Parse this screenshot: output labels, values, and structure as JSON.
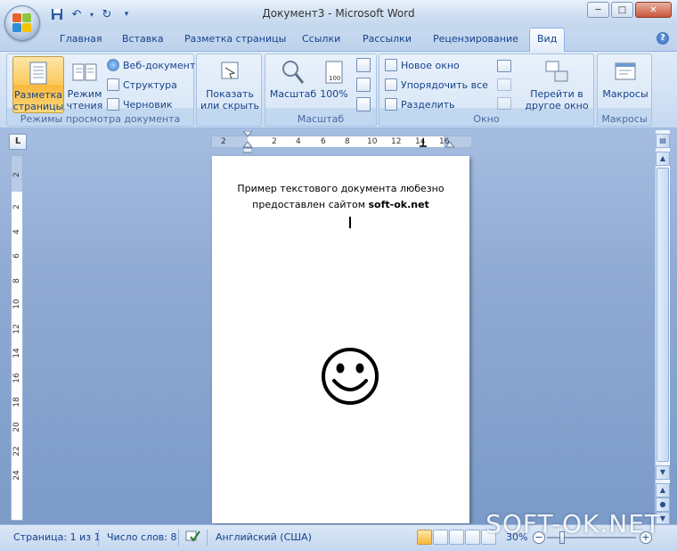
{
  "window": {
    "title": "Документ3 - Microsoft Word"
  },
  "qat": {
    "icons": [
      "save-icon",
      "undo-icon",
      "redo-icon",
      "customize-icon"
    ]
  },
  "tabs": [
    {
      "label": "Главная"
    },
    {
      "label": "Вставка"
    },
    {
      "label": "Разметка страницы"
    },
    {
      "label": "Ссылки"
    },
    {
      "label": "Рассылки"
    },
    {
      "label": "Рецензирование"
    },
    {
      "label": "Вид"
    }
  ],
  "ribbon": {
    "views": {
      "name": "Режимы просмотра документа",
      "page_layout": "Разметка страницы",
      "reading": "Режим чтения",
      "web": "Веб-документ",
      "outline": "Структура",
      "draft": "Черновик"
    },
    "show": {
      "label": "Показать или скрыть"
    },
    "zoom": {
      "name": "Масштаб",
      "zoom_label": "Масштаб",
      "percent_label": "100%"
    },
    "window": {
      "name": "Окно",
      "new_window": "Новое окно",
      "arrange_all": "Упорядочить все",
      "split": "Разделить",
      "switch": "Перейти в другое окно"
    },
    "macros": {
      "name": "Макросы",
      "label": "Макросы"
    }
  },
  "ruler": {
    "h_ticks": [
      "2",
      "2",
      "4",
      "6",
      "8",
      "10",
      "12",
      "14",
      "16"
    ],
    "v_ticks": [
      "2",
      "2",
      "4",
      "6",
      "8",
      "10",
      "12",
      "14",
      "16",
      "18",
      "20",
      "22",
      "24"
    ]
  },
  "document": {
    "line1": "Пример текстового документа любезно",
    "line2_prefix": "предоставлен сайтом ",
    "line2_bold": "soft-ok.net"
  },
  "status": {
    "page": "Страница: 1 из 1",
    "words": "Число слов: 8",
    "language": "Английский (США)",
    "zoom": "30%"
  },
  "watermark": "SOFT-OK.NET",
  "colors": {
    "accent": "#15428b",
    "active_button": "#f9b83a"
  }
}
